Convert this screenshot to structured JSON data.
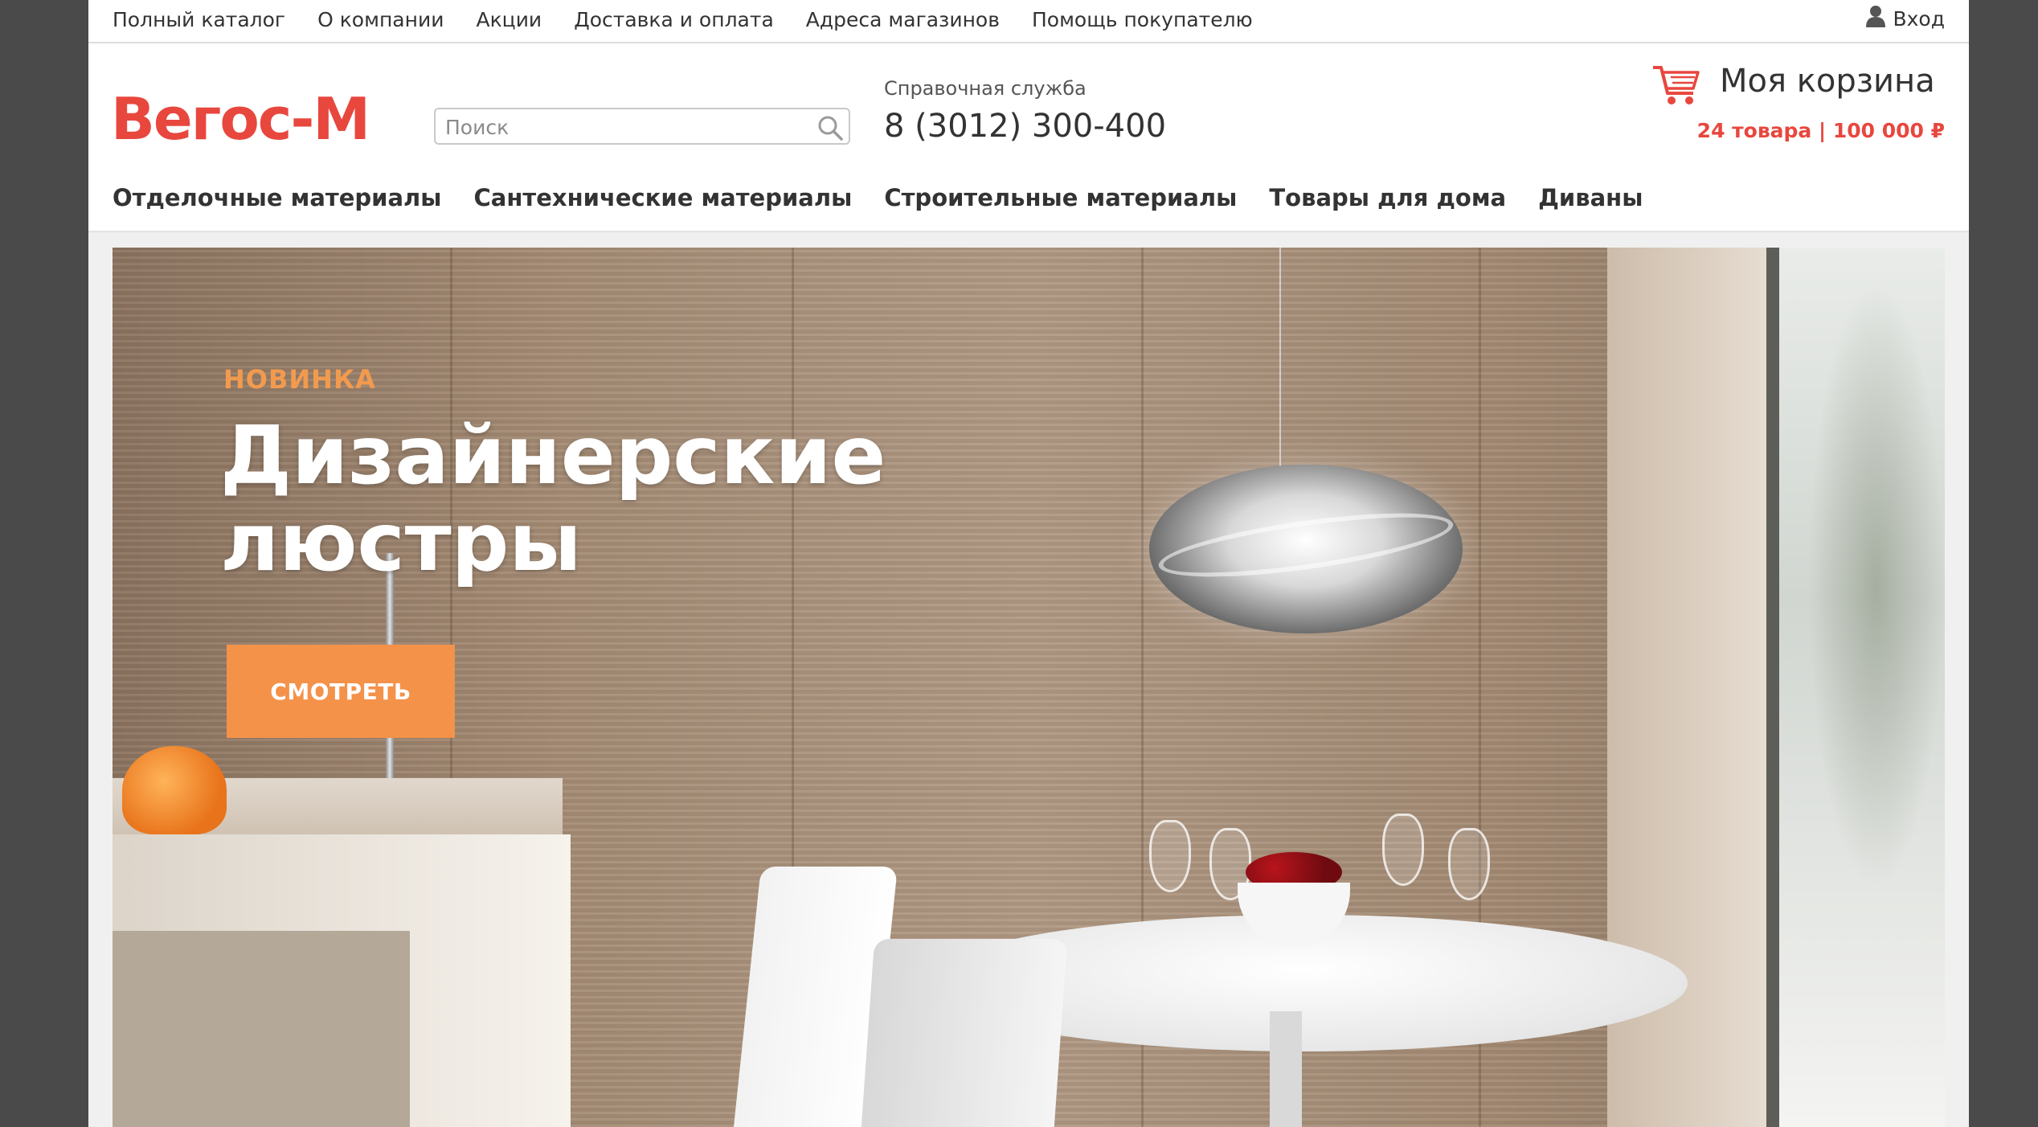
{
  "top_nav": {
    "items": [
      {
        "label": "Полный каталог"
      },
      {
        "label": "О компании"
      },
      {
        "label": "Акции"
      },
      {
        "label": "Доставка и оплата"
      },
      {
        "label": "Адреса магазинов"
      },
      {
        "label": "Помощь покупателю"
      }
    ],
    "login_label": "Вход",
    "login_icon": "user-icon"
  },
  "header": {
    "logo_text": "Вегос-М",
    "brand_color": "#e8473e",
    "search": {
      "placeholder": "Поиск",
      "value": "",
      "icon": "search-icon"
    },
    "help": {
      "label": "Справочная служба",
      "phone": "8 (3012) 300-400"
    },
    "cart": {
      "title": "Моя корзина",
      "summary": "24 товара | 100 000 ₽",
      "icon": "cart-icon"
    }
  },
  "main_nav": {
    "items": [
      {
        "label": "Отделочные материалы"
      },
      {
        "label": "Сантехнические материалы"
      },
      {
        "label": "Строительные материалы"
      },
      {
        "label": "Товары для дома"
      },
      {
        "label": "Диваны"
      }
    ]
  },
  "banner": {
    "eyebrow": "НОВИНКА",
    "headline_line1": "Дизайнерские",
    "headline_line2": "люстры",
    "button_label": "СМОТРЕТЬ",
    "accent_color": "#f4924a"
  }
}
